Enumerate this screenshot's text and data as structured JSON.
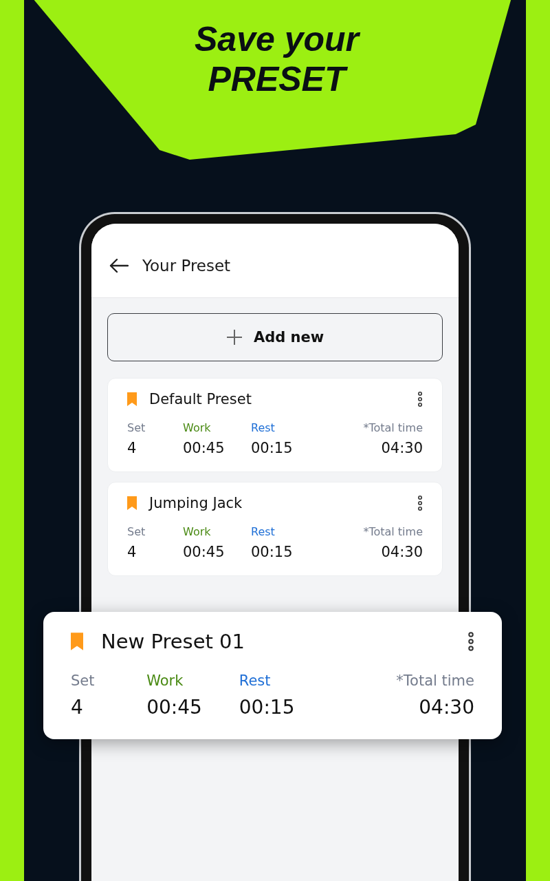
{
  "headline": [
    "Save your",
    "PRESET"
  ],
  "screen": {
    "title": "Your Preset",
    "add_button": "Add new",
    "presets": [
      {
        "name": "Default Preset",
        "stats": [
          {
            "kind": "set",
            "label": "Set",
            "value": "4"
          },
          {
            "kind": "work",
            "label": "Work",
            "value": "00:45"
          },
          {
            "kind": "rest",
            "label": "Rest",
            "value": "00:15"
          },
          {
            "kind": "total",
            "label": "*Total time",
            "value": "04:30"
          }
        ]
      },
      {
        "name": "Jumping Jack",
        "stats": [
          {
            "kind": "set",
            "label": "Set",
            "value": "4"
          },
          {
            "kind": "work",
            "label": "Work",
            "value": "00:45"
          },
          {
            "kind": "rest",
            "label": "Rest",
            "value": "00:15"
          },
          {
            "kind": "total",
            "label": "*Total time",
            "value": "04:30"
          }
        ]
      }
    ]
  },
  "featured_preset": {
    "name": "New Preset 01",
    "stats": [
      {
        "kind": "set",
        "label": "Set",
        "value": "4"
      },
      {
        "kind": "work",
        "label": "Work",
        "value": "00:45"
      },
      {
        "kind": "rest",
        "label": "Rest",
        "value": "00:15"
      },
      {
        "kind": "total",
        "label": "*Total time",
        "value": "04:30"
      }
    ]
  }
}
